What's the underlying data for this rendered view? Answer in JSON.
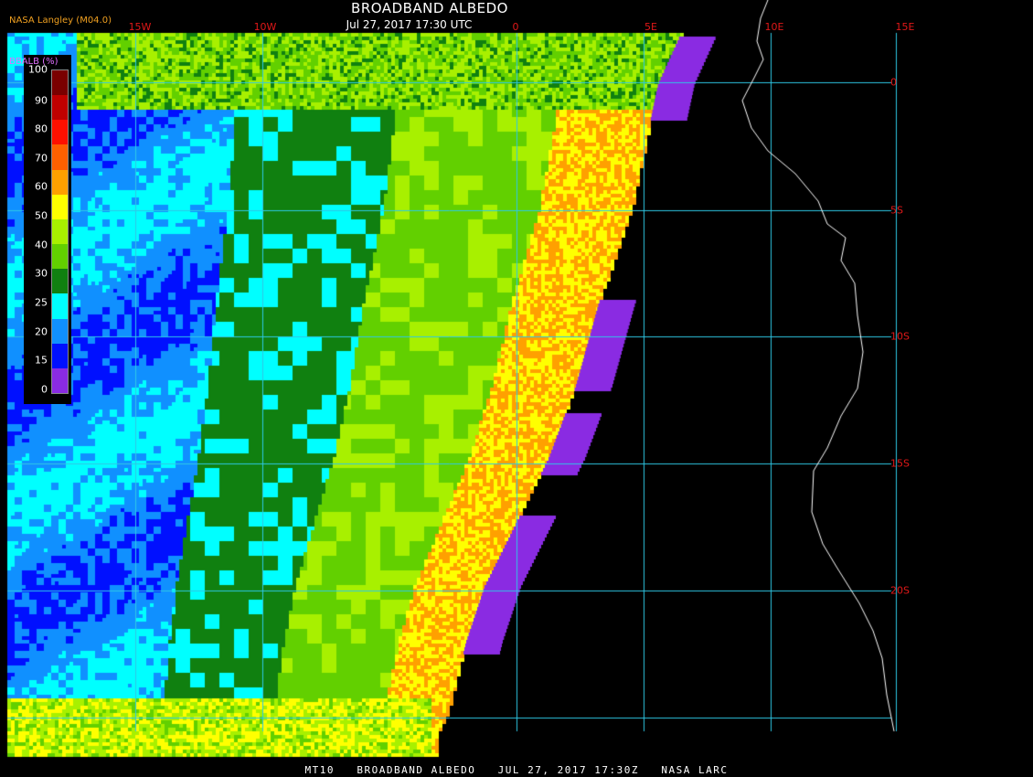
{
  "header": {
    "title": "BROADBAND ALBEDO",
    "subtitle": "Jul 27, 2017 17:30 UTC",
    "producer": "NASA Langley (M04.0)"
  },
  "footer": {
    "caption": "MT10   BROADBAND ALBEDO   JUL 27, 2017 17:30Z   NASA LARC"
  },
  "longitude_labels": [
    "15W",
    "10W",
    "0",
    "5E",
    "10E",
    "15E"
  ],
  "latitude_labels": [
    "0",
    "5S",
    "10S",
    "15S",
    "20S"
  ],
  "legend": {
    "title": "BBALB (%)",
    "ticks": [
      "100",
      "90",
      "80",
      "70",
      "60",
      "50",
      "40",
      "30",
      "25",
      "20",
      "15",
      "10",
      "0"
    ],
    "colors": [
      "#7a0000",
      "#c00000",
      "#ff1000",
      "#ff6000",
      "#ffa000",
      "#ffff00",
      "#a8f000",
      "#62d000",
      "#108010",
      "#00ffff",
      "#1090ff",
      "#0010ff",
      "#8a2be2"
    ]
  },
  "colors": {
    "gridline": "#2ec8e6",
    "coastline": "#ffffff",
    "label_red": "#e01818",
    "background": "#000000"
  }
}
